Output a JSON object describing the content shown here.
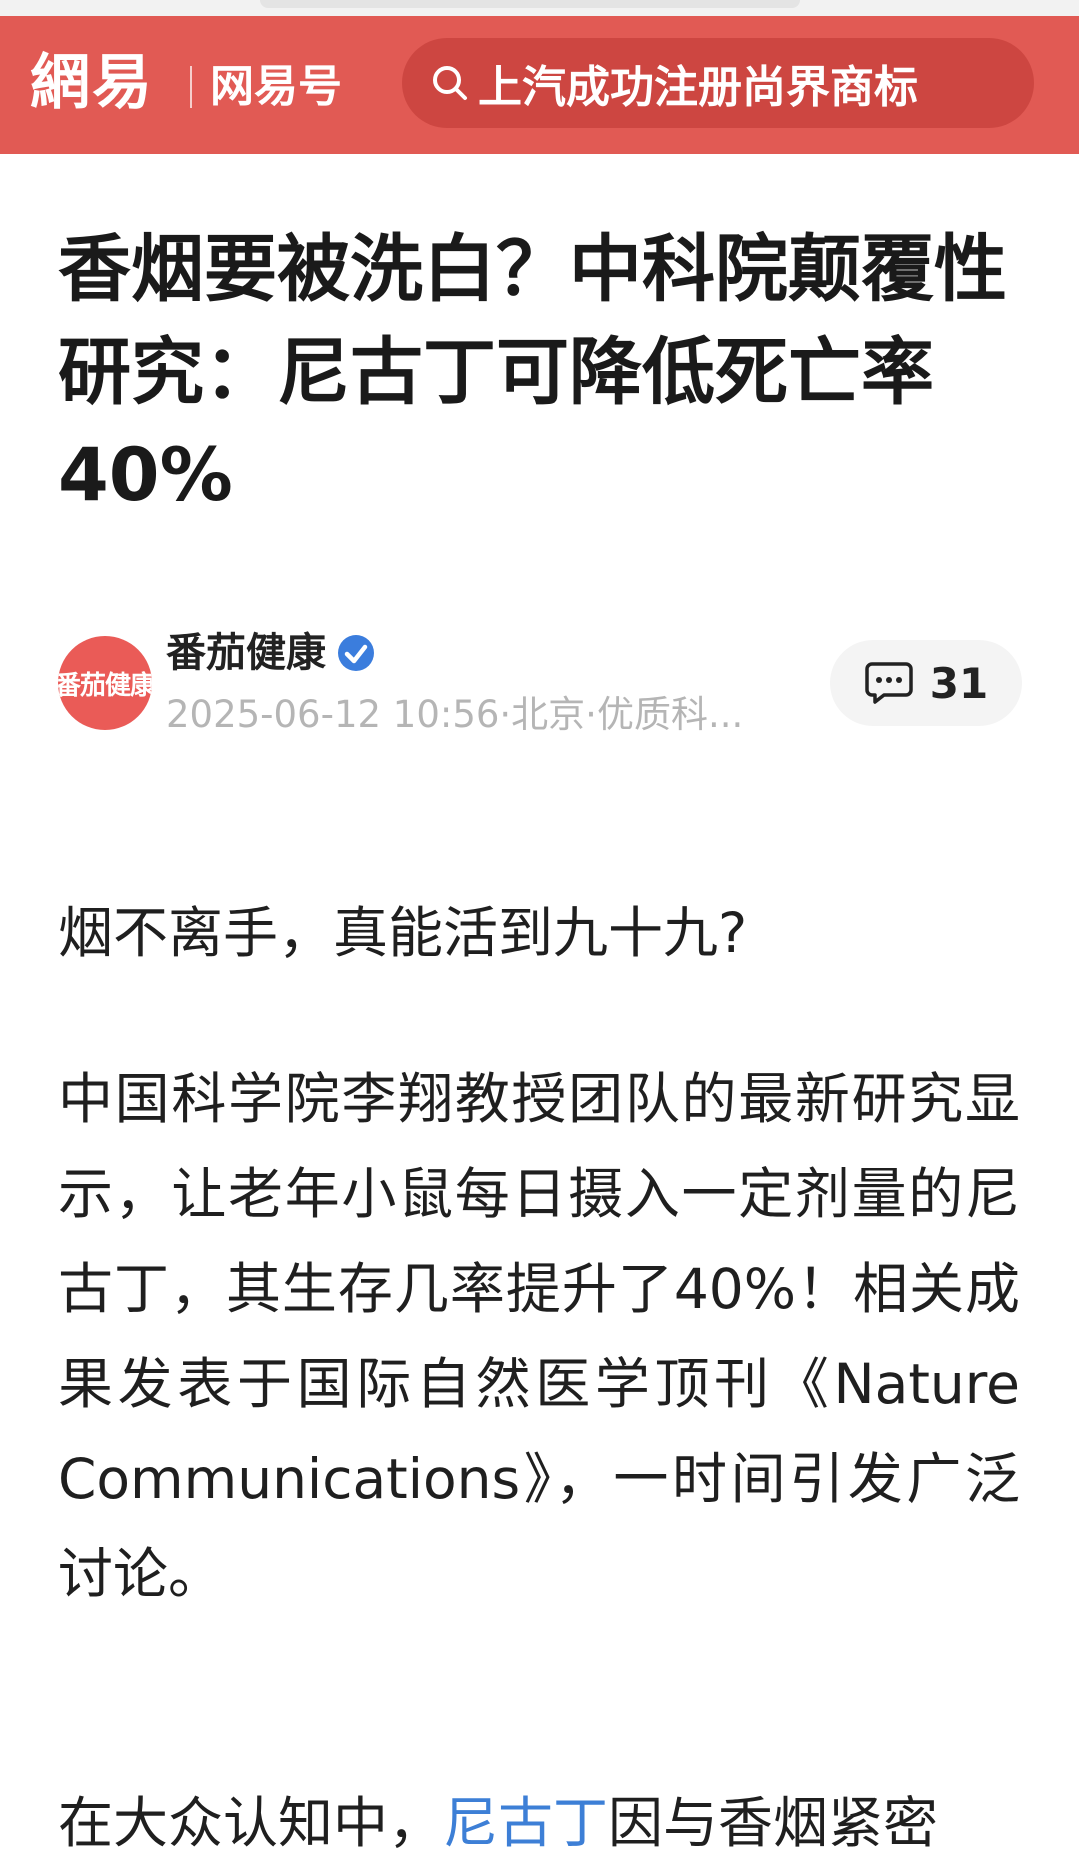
{
  "header": {
    "logo": "網易",
    "channel": "网易号",
    "search_text": "上汽成功注册尚界商标",
    "bg_color": "#e15a54"
  },
  "article": {
    "title": "香烟要被洗白？中科院颠覆性研究：尼古丁可降低死亡率40%",
    "author": {
      "name": "番茄健康",
      "avatar_text": "番茄健康",
      "verified": true,
      "meta": "2025-06-12 10:56·北京·优质科..."
    },
    "comment_count": "31",
    "paragraphs": {
      "p1": "烟不离手，真能活到九十九?",
      "p2": "中国科学院李翔教授团队的最新研究显示，让老年小鼠每日摄入一定剂量的尼古丁，其生存几率提升了40%！相关成果发表于国际自然医学顶刊《Nature Communications》，一时间引发广泛讨论。",
      "p3_before": "在大众认知中，",
      "p3_link": "尼古丁",
      "p3_after": "因与香烟紧密"
    },
    "link_color": "#3d7fd6"
  }
}
